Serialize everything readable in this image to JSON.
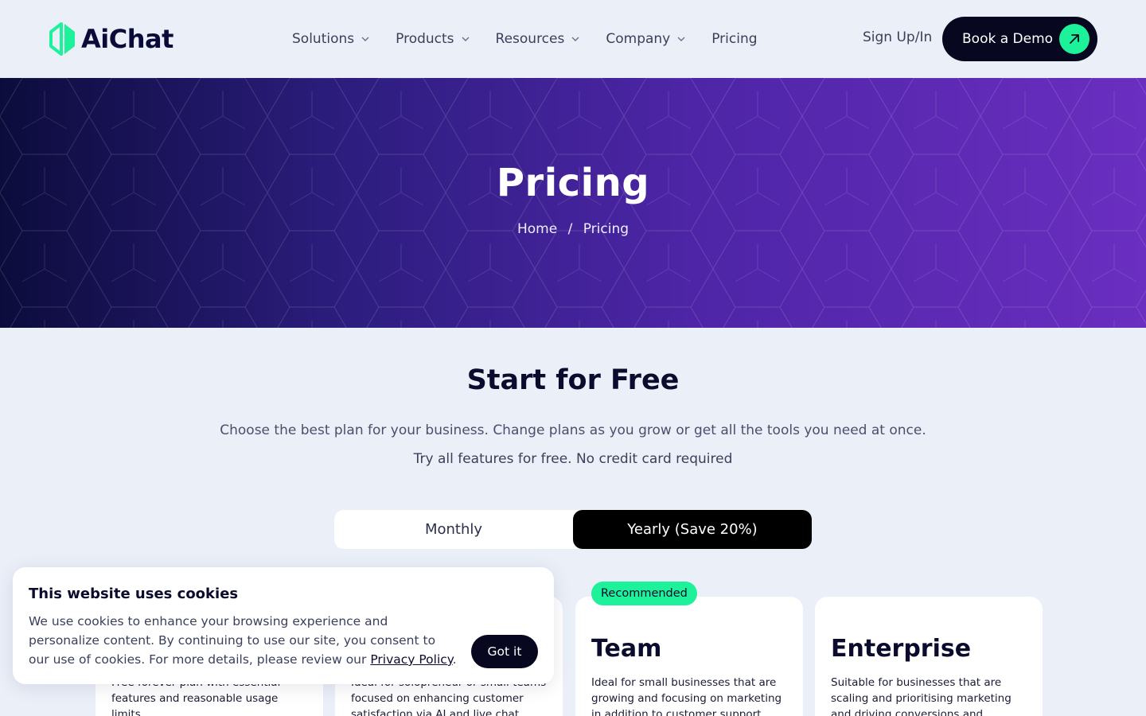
{
  "header": {
    "logo_text": "AiChat",
    "nav": [
      {
        "label": "Solutions",
        "has_dropdown": true
      },
      {
        "label": "Products",
        "has_dropdown": true
      },
      {
        "label": "Resources",
        "has_dropdown": true
      },
      {
        "label": "Company",
        "has_dropdown": true
      },
      {
        "label": "Pricing",
        "has_dropdown": false
      }
    ],
    "signin_label": "Sign Up/In",
    "demo_label": "Book a Demo",
    "brand_color": "#1df29a"
  },
  "hero": {
    "title": "Pricing",
    "breadcrumb": {
      "home": "Home",
      "separator": "/",
      "current": "Pricing"
    }
  },
  "main": {
    "title": "Start for Free",
    "subtitle": "Choose the best plan for your business. Change plans as you grow or get all the tools you need at once.",
    "subtitle2": "Try all features for free. No credit card required",
    "toggle": {
      "monthly": "Monthly",
      "yearly": "Yearly (Save 20%)",
      "selected": "yearly"
    },
    "plans": [
      {
        "name": "",
        "desc": "Free forever plan with essential features and reasonable usage limits",
        "badge": ""
      },
      {
        "name": "",
        "desc": "Ideal for solopreneur or small teams focused on enhancing customer satisfaction via AI and live chat",
        "badge": ""
      },
      {
        "name": "Team",
        "desc": "Ideal for small businesses that are growing and focusing on marketing in addition to customer support",
        "badge": "Recommended"
      },
      {
        "name": "Enterprise",
        "desc": "Suitable for businesses that are scaling and prioritising marketing and driving conversions and requiring",
        "badge": ""
      }
    ]
  },
  "cookie": {
    "title": "This website uses cookies",
    "text": "We use cookies to enhance your browsing experience and personalize content. By continuing to use our site, you consent to our use of cookies. For more details, please review our ",
    "link": "Privacy Policy",
    "after_link": ".",
    "button": "Got it"
  }
}
